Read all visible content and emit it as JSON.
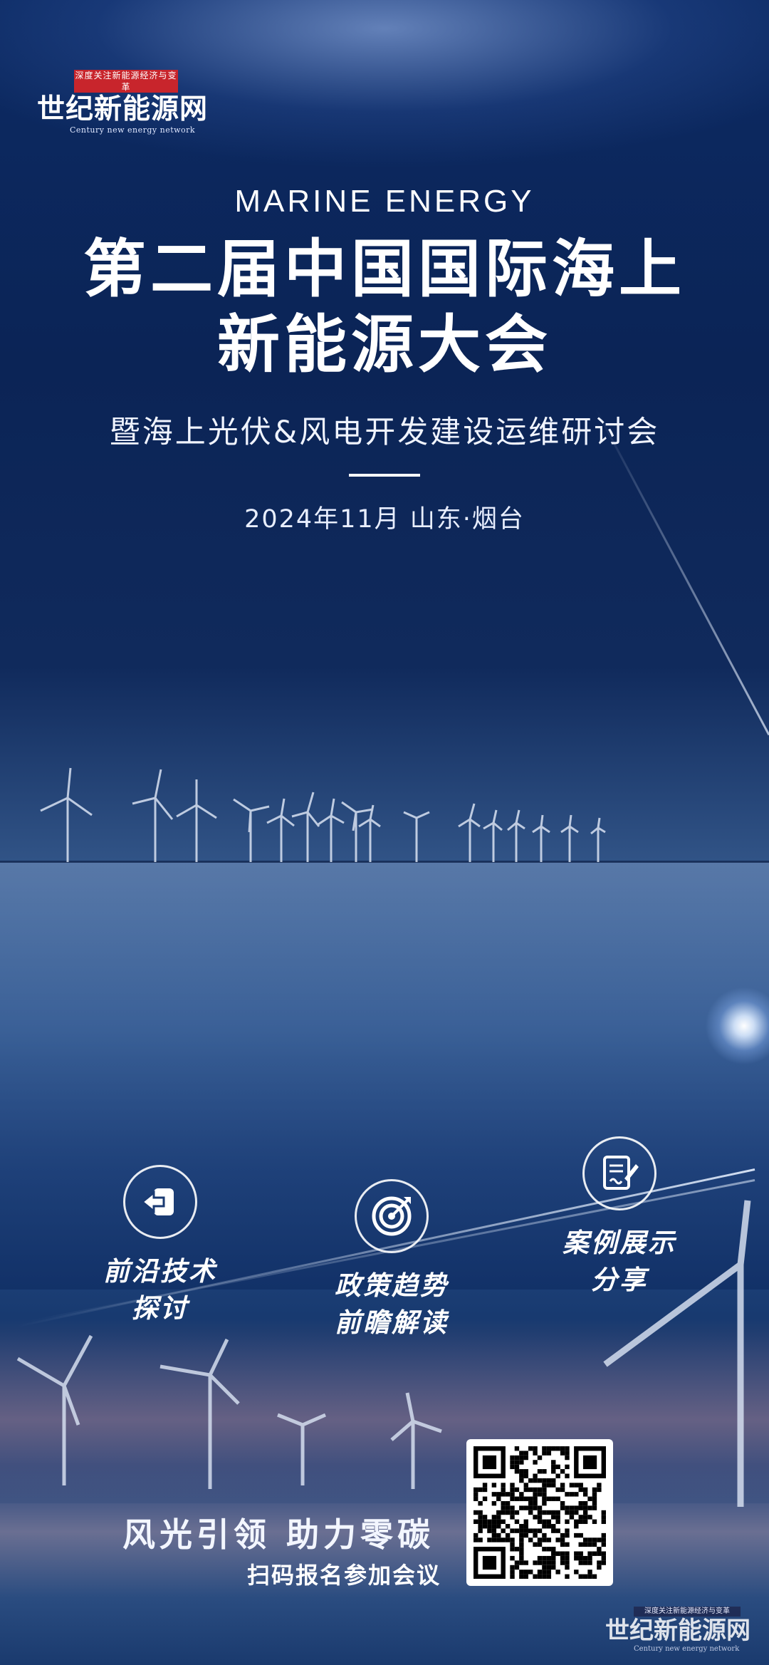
{
  "brand": {
    "tagline": "深度关注新能源经济与变革",
    "name": "世纪新能源网",
    "english": "Century new energy network"
  },
  "hero": {
    "subtitle_en": "MARINE ENERGY",
    "title_line1": "第二届中国国际海上",
    "title_line2": "新能源大会",
    "tagline": "暨海上光伏&风电开发建设运维研讨会",
    "date_location": "2024年11月  山东·烟台"
  },
  "features": [
    {
      "icon": "exit-arrow-icon",
      "line1": "前沿技术",
      "line2": "探讨"
    },
    {
      "icon": "target-icon",
      "line1": "政策趋势",
      "line2": "前瞻解读"
    },
    {
      "icon": "document-pen-icon",
      "line1": "案例展示",
      "line2": "分享"
    }
  ],
  "footer": {
    "slogan": "风光引领  助力零碳",
    "cta": "扫码报名参加会议"
  },
  "watermark": {
    "tagline": "深度关注新能源经济与变革",
    "name": "世纪新能源网",
    "english": "Century new energy network"
  },
  "colors": {
    "background": "#0c2a63",
    "accent_red": "#c8252c",
    "text": "#ffffff"
  }
}
